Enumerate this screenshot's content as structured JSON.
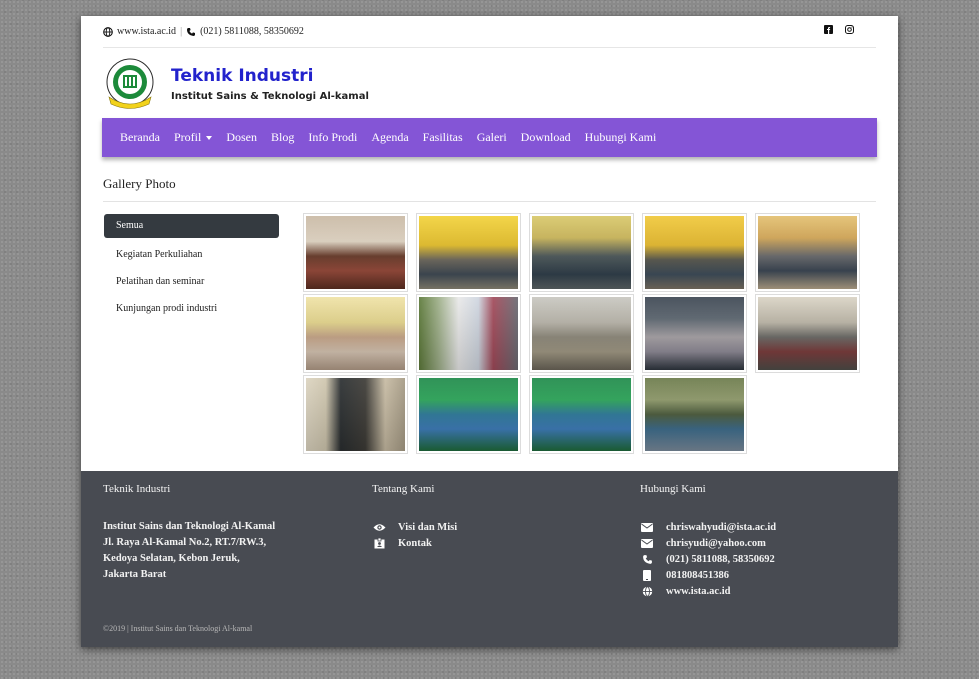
{
  "topbar": {
    "website": "www.ista.ac.id",
    "phone": "(021) 5811088, 58350692",
    "social": [
      "facebook-icon",
      "instagram-icon"
    ]
  },
  "brand": {
    "title": "Teknik Industri",
    "subtitle": "Institut Sains & Teknologi Al-kamal",
    "logo_text": "ISTA",
    "logo_ring_text": "INSTITUT SAINS DAN TEKNOLOGI AL-KAMAL"
  },
  "nav": {
    "items": [
      "Beranda",
      "Profil",
      "Dosen",
      "Blog",
      "Info Prodi",
      "Agenda",
      "Fasilitas",
      "Galeri",
      "Download",
      "Hubungi Kami"
    ],
    "color": "#8455d6"
  },
  "gallery": {
    "title": "Gallery Photo",
    "categories": [
      "Semua",
      "Kegiatan Perkuliahan",
      "Pelatihan dan seminar",
      "Kunjungan prodi industri"
    ],
    "active_category": "Semua",
    "photos": [
      {
        "scene": "classroom-students"
      },
      {
        "scene": "computer-lab"
      },
      {
        "scene": "computer-lab-crowd"
      },
      {
        "scene": "computer-lab-yellow"
      },
      {
        "scene": "workshop-floor"
      },
      {
        "scene": "seminar-hall"
      },
      {
        "scene": "group-outdoor"
      },
      {
        "scene": "visitors-indoor"
      },
      {
        "scene": "two-women-portrait"
      },
      {
        "scene": "office-meeting"
      },
      {
        "scene": "presentation-blackboard"
      },
      {
        "scene": "stage-students"
      },
      {
        "scene": "stage-students-2"
      },
      {
        "scene": "outdoor-gathering"
      }
    ]
  },
  "footer": {
    "col1": {
      "heading": "Teknik Industri",
      "address": [
        "Institut Sains dan Teknologi Al-Kamal",
        "Jl. Raya Al-Kamal No.2, RT.7/RW.3,",
        "Kedoya Selatan, Kebon Jeruk,",
        "Jakarta Barat"
      ]
    },
    "col2": {
      "heading": "Tentang Kami",
      "links": [
        "Visi dan Misi",
        "Kontak"
      ]
    },
    "col3": {
      "heading": "Hubungi Kami",
      "contacts": [
        "chriswahyudi@ista.ac.id",
        "chrisyudi@yahoo.com",
        "(021) 5811088, 58350692",
        "081808451386",
        "www.ista.ac.id"
      ]
    },
    "copyright": "©2019 | Institut Sains dan Teknologi Al-kamal"
  }
}
